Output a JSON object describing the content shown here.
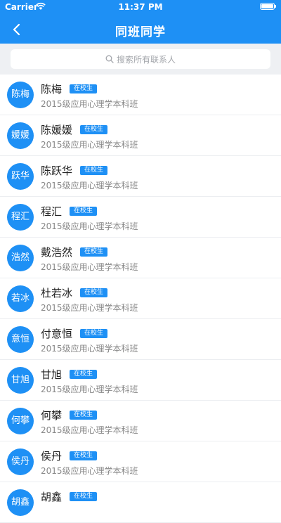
{
  "status_bar": {
    "carrier": "Carrier",
    "time": "11:37 PM"
  },
  "nav": {
    "title": "同班同学"
  },
  "search": {
    "placeholder": "搜索所有联系人"
  },
  "colors": {
    "primary": "#1e90f5",
    "search_bg": "#eef0f3"
  },
  "classmates": [
    {
      "avatar": "陈梅",
      "name": "陈梅",
      "badge": "在校生",
      "class": "2015级应用心理学本科班"
    },
    {
      "avatar": "媛媛",
      "name": "陈媛媛",
      "badge": "在校生",
      "class": "2015级应用心理学本科班"
    },
    {
      "avatar": "跃华",
      "name": "陈跃华",
      "badge": "在校生",
      "class": "2015级应用心理学本科班"
    },
    {
      "avatar": "程汇",
      "name": "程汇",
      "badge": "在校生",
      "class": "2015级应用心理学本科班"
    },
    {
      "avatar": "浩然",
      "name": "戴浩然",
      "badge": "在校生",
      "class": "2015级应用心理学本科班"
    },
    {
      "avatar": "若冰",
      "name": "杜若冰",
      "badge": "在校生",
      "class": "2015级应用心理学本科班"
    },
    {
      "avatar": "意恒",
      "name": "付意恒",
      "badge": "在校生",
      "class": "2015级应用心理学本科班"
    },
    {
      "avatar": "甘旭",
      "name": "甘旭",
      "badge": "在校生",
      "class": "2015级应用心理学本科班"
    },
    {
      "avatar": "何攀",
      "name": "何攀",
      "badge": "在校生",
      "class": "2015级应用心理学本科班"
    },
    {
      "avatar": "侯丹",
      "name": "侯丹",
      "badge": "在校生",
      "class": "2015级应用心理学本科班"
    },
    {
      "avatar": "胡鑫",
      "name": "胡鑫",
      "badge": "在校生",
      "class": ""
    }
  ]
}
